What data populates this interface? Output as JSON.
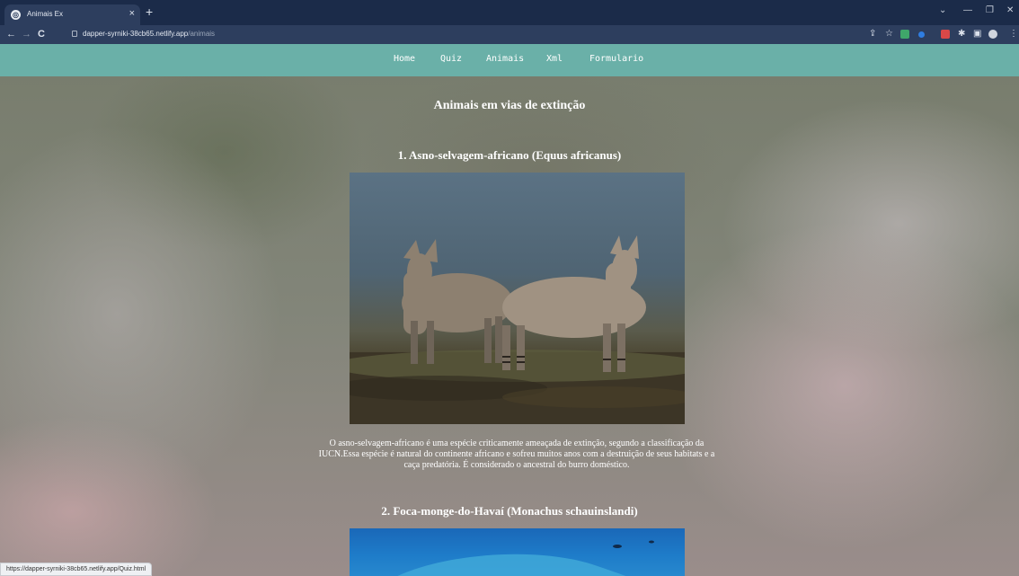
{
  "browser": {
    "tab": {
      "title": "Animais Ex",
      "favicon": "globe-icon"
    },
    "new_tab_label": "+",
    "url": {
      "host": "dapper-syrniki-38cb65.netlify.app",
      "path": "/animais"
    },
    "nav": {
      "back": "←",
      "forward": "→",
      "reload": "C"
    },
    "status_url": "https://dapper-syrniki-38cb65.netlify.app/Quiz.html"
  },
  "site_nav": {
    "items": [
      "Home",
      "Quiz",
      "Animais",
      "Xml",
      "Formulario"
    ]
  },
  "page": {
    "title": "Animais em vias de extinção",
    "animals": [
      {
        "heading": "1. Asno-selvagem-africano (Equus africanus)",
        "description": "O asno-selvagem-africano é uma espécie criticamente ameaçada de extinção, segundo a classificação da IUCN.Essa espécie é natural do continente africano e sofreu muitos anos com a destruição de seus habitats e a caça predatória. É considerado o ancestral do burro doméstico."
      },
      {
        "heading": "2. Foca-monge-do-Havaí (Monachus schauinslandi)"
      }
    ]
  },
  "colors": {
    "navbar": "#6ab0a8",
    "browser_frame": "#1b2b49",
    "address_bar": "#2d3e5e"
  }
}
